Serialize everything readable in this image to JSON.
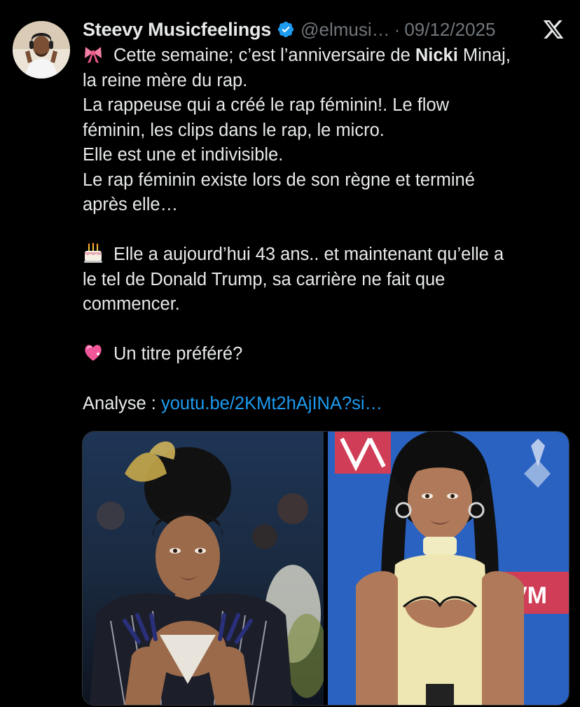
{
  "tweet": {
    "author": {
      "display_name": "Steevy Musicfeelings",
      "handle": "@elmusi…",
      "verified_icon": "verified-badge-icon",
      "avatar": "avatar"
    },
    "separator": "·",
    "date": "09/12/2025",
    "platform_icon": "x-logo-icon",
    "lines": [
      {
        "emoji": "ribbon-emoji-icon",
        "pre": "Cette semaine; c’est l’anniversaire de ",
        "bold": "Nicki",
        "post": " Minaj,"
      },
      {
        "text": "la reine mère du rap."
      },
      {
        "text": "La rappeuse qui a créé le rap féminin!. Le flow"
      },
      {
        "text": "féminin, les clips dans le rap, le micro."
      },
      {
        "text": "Elle est une et indivisible."
      },
      {
        "text": "Le rap féminin existe lors de son règne et terminé"
      },
      {
        "text": "après elle…"
      },
      {
        "emoji": "birthday-cake-emoji-icon",
        "text": "Elle a aujourd’hui 43 ans.. et maintenant qu’elle a"
      },
      {
        "text": "le tel de Donald Trump, sa carrière ne fait que"
      },
      {
        "text": "commencer."
      },
      {
        "emoji": "sparkling-heart-emoji-icon",
        "text": "Un titre préféré?"
      },
      {
        "label": "Analyse : ",
        "link": "youtu.be/2KMt2hAjINA?si…"
      }
    ],
    "media": [
      {
        "name": "photo-met-gala",
        "background": "#1e2f4a"
      },
      {
        "name": "photo-vma-red-carpet",
        "background": "#2a64c4"
      }
    ]
  },
  "colors": {
    "background": "#000000",
    "text": "#e7e9ea",
    "secondary_text": "#71767b",
    "link": "#1d9bf0",
    "verified": "#1d9bf0"
  }
}
